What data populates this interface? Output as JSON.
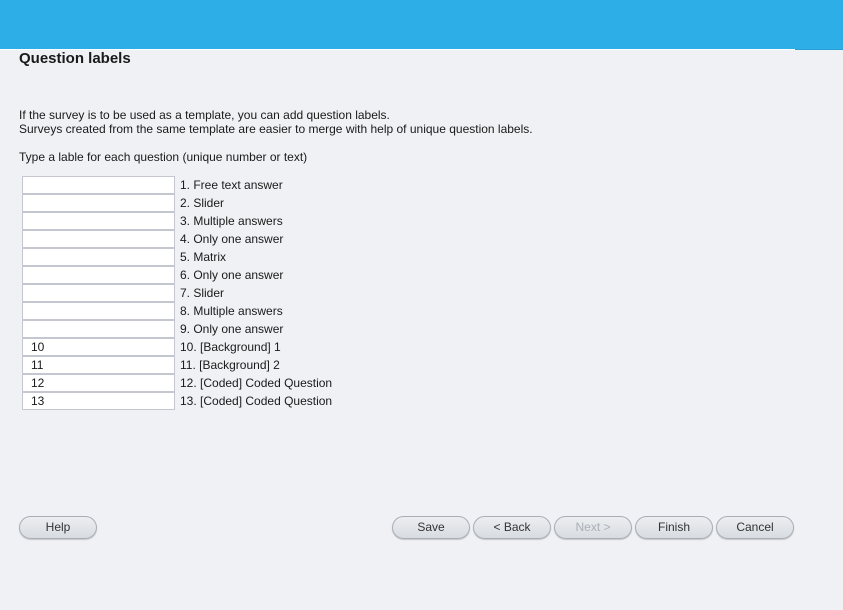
{
  "page": {
    "title": "Question labels",
    "description_line1": "If the survey is to be used as a template, you can add question labels.",
    "description_line2": "Surveys created from the same template are easier to merge with help of unique question labels.",
    "instruction": "Type a lable for each question (unique number or text)"
  },
  "questions": [
    {
      "value": "",
      "label": "1. Free text answer"
    },
    {
      "value": "",
      "label": "2. Slider"
    },
    {
      "value": "",
      "label": "3. Multiple answers"
    },
    {
      "value": "",
      "label": "4. Only one answer"
    },
    {
      "value": "",
      "label": "5. Matrix"
    },
    {
      "value": "",
      "label": "6. Only one answer"
    },
    {
      "value": "",
      "label": "7. Slider"
    },
    {
      "value": "",
      "label": "8. Multiple answers"
    },
    {
      "value": "",
      "label": "9. Only one answer"
    },
    {
      "value": "10",
      "label": "10. [Background] 1"
    },
    {
      "value": "11",
      "label": "11. [Background] 2"
    },
    {
      "value": "12",
      "label": "12. [Coded] Coded Question"
    },
    {
      "value": "13",
      "label": "13. [Coded] Coded Question"
    }
  ],
  "buttons": {
    "help": "Help",
    "save": "Save",
    "back": "< Back",
    "next": "Next >",
    "finish": "Finish",
    "cancel": "Cancel"
  },
  "colors": {
    "header": "#2daee6",
    "background": "#f0f1f5"
  }
}
